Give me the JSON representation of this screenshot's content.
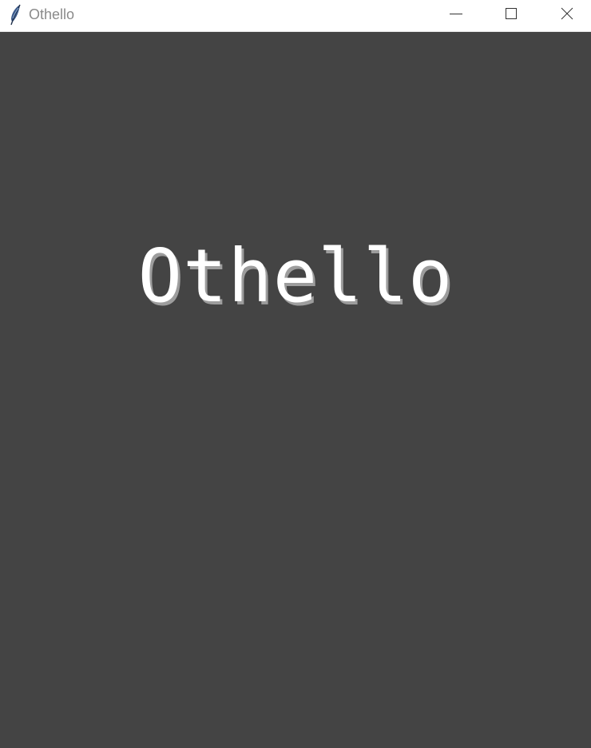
{
  "window": {
    "title": "Othello",
    "app_icon": "feather-icon",
    "controls": {
      "minimize": "minimize-icon",
      "maximize": "maximize-icon",
      "close": "close-icon"
    }
  },
  "canvas": {
    "background_color": "#444444",
    "game_title": "Othello",
    "title_color": "#ffffff",
    "title_shadow_color": "#9d9d9d"
  }
}
